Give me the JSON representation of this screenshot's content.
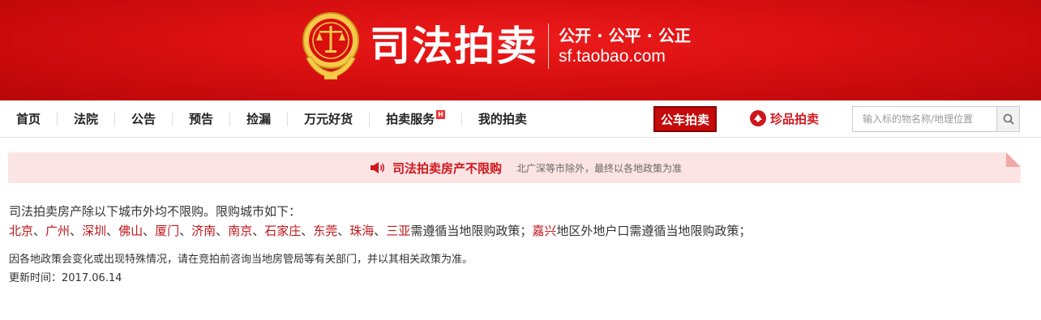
{
  "brand": {
    "title": "司法拍卖",
    "slogan": "公开 · 公平 · 公正",
    "domain": "sf.taobao.com"
  },
  "nav": {
    "items": [
      {
        "label": "首页"
      },
      {
        "label": "法院"
      },
      {
        "label": "公告"
      },
      {
        "label": "预告"
      },
      {
        "label": "捡漏"
      },
      {
        "label": "万元好货"
      },
      {
        "label": "拍卖服务",
        "badge": "H"
      },
      {
        "label": "我的拍卖"
      }
    ],
    "car_auction": "公车拍卖",
    "gem_auction": "珍品拍卖",
    "search_placeholder": "输入标的物名称/地理位置"
  },
  "notice": {
    "title": "司法拍卖房产不限购",
    "subtitle": "北广深等市除外，最终以各地政策为准"
  },
  "content": {
    "intro": "司法拍卖房产除以下城市外均不限购。限购城市如下：",
    "cities": [
      "北京",
      "广州",
      "深圳",
      "佛山",
      "厦门",
      "济南",
      "南京",
      "石家庄",
      "东莞",
      "珠海",
      "三亚"
    ],
    "city_sep": "、",
    "cities_policy": "需遵循当地限购政策；",
    "special_city": "嘉兴",
    "special_policy": "地区外地户口需遵循当地限购政策；",
    "note": "因各地政策会变化或出现特殊情况，请在竞拍前咨询当地房管局等有关部门，并以其相关政策为准。",
    "updated": "更新时间：2017.06.14"
  },
  "colors": {
    "banner_red": "#d90f10",
    "accent_red": "#c0161c",
    "notice_bg": "#fde4e4"
  }
}
